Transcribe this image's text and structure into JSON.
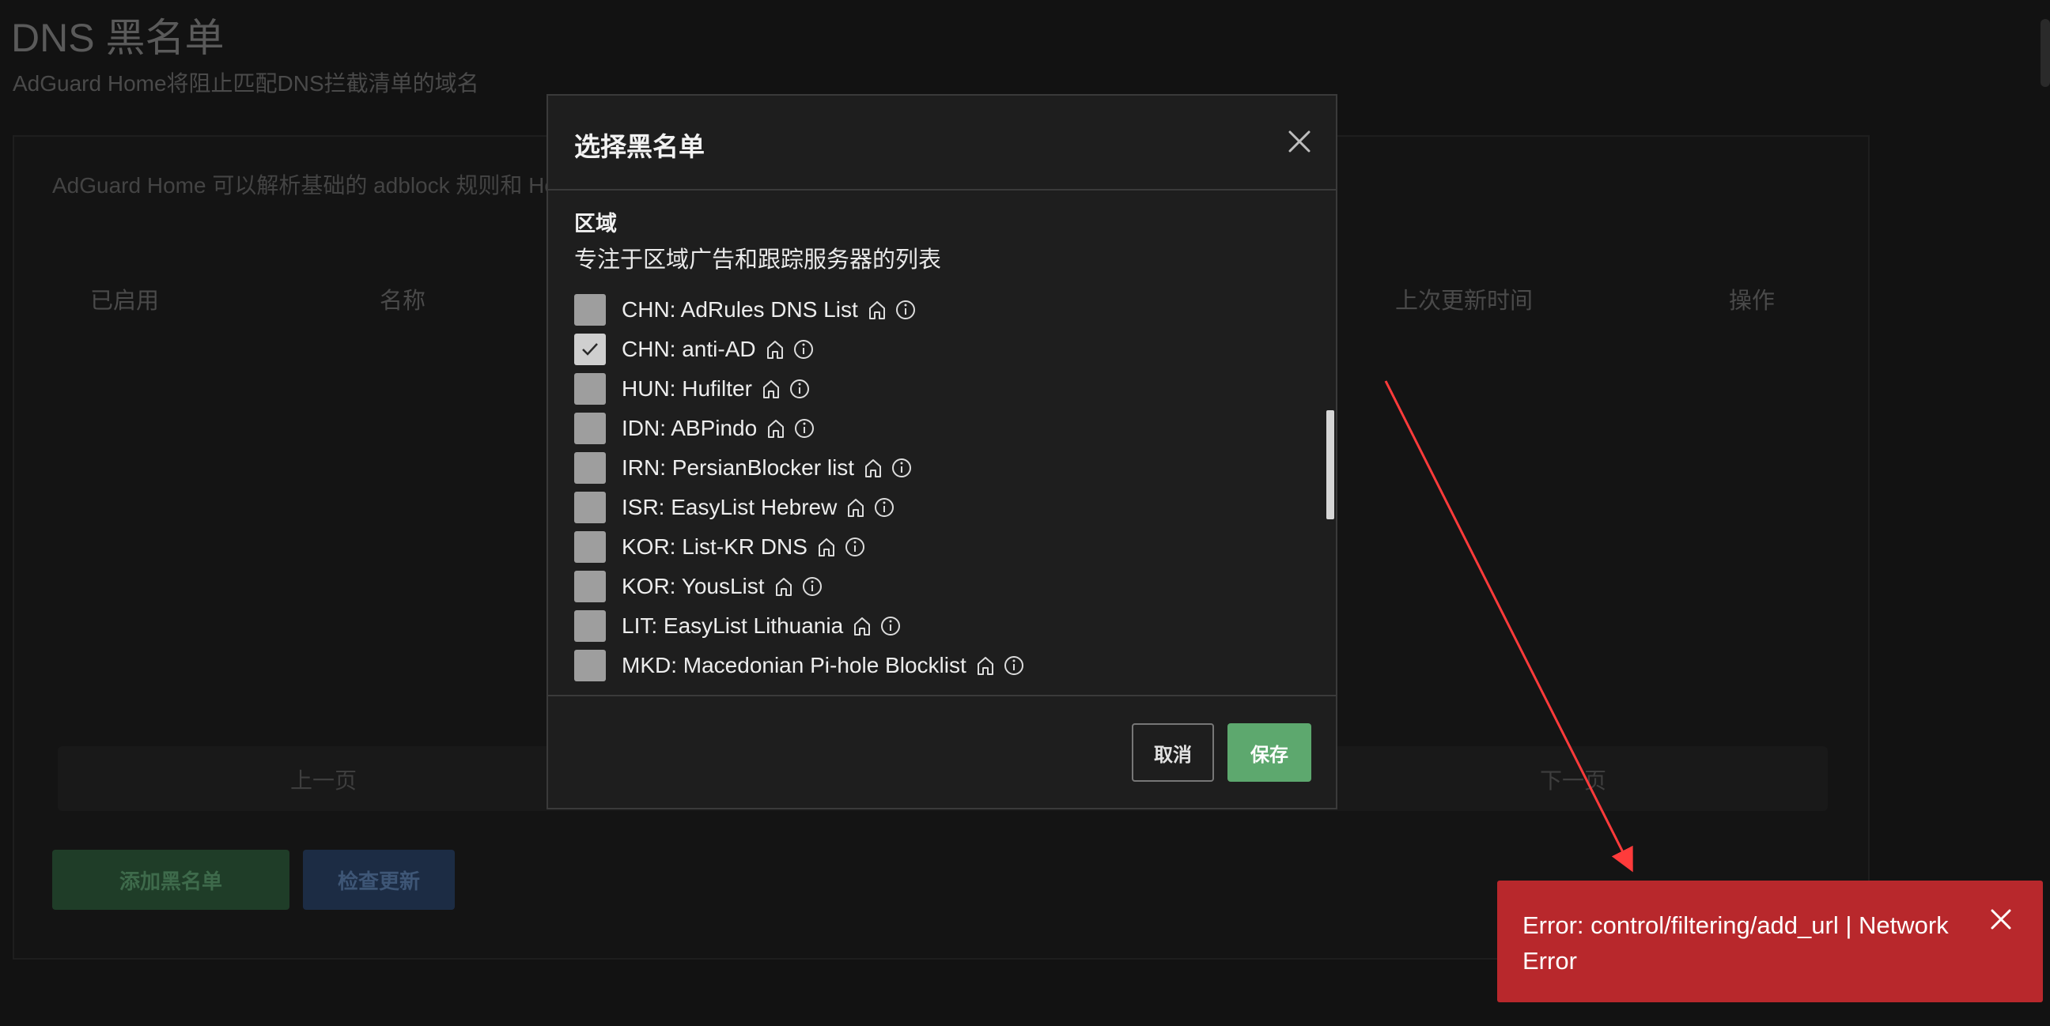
{
  "page": {
    "title": "DNS 黑名单",
    "subtitle": "AdGuard Home将阻止匹配DNS拦截清单的域名"
  },
  "card": {
    "description": "AdGuard Home 可以解析基础的 adblock 规则和 Ho",
    "columns": [
      "已启用",
      "名称",
      "上次更新时间",
      "操作"
    ],
    "pager": {
      "prev": "上一页",
      "next": "下一页"
    },
    "add_button": "添加黑名单",
    "check_button": "检查更新"
  },
  "modal": {
    "title": "选择黑名单",
    "section_title": "区域",
    "section_desc": "专注于区域广告和跟踪服务器的列表",
    "items": [
      {
        "label": "CHN: AdRules DNS List",
        "checked": false
      },
      {
        "label": "CHN: anti-AD",
        "checked": true
      },
      {
        "label": "HUN: Hufilter",
        "checked": false
      },
      {
        "label": "IDN: ABPindo",
        "checked": false
      },
      {
        "label": "IRN: PersianBlocker list",
        "checked": false
      },
      {
        "label": "ISR: EasyList Hebrew",
        "checked": false
      },
      {
        "label": "KOR: List-KR DNS",
        "checked": false
      },
      {
        "label": "KOR: YousList",
        "checked": false
      },
      {
        "label": "LIT: EasyList Lithuania",
        "checked": false
      },
      {
        "label": "MKD: Macedonian Pi-hole Blocklist",
        "checked": false
      }
    ],
    "cancel": "取消",
    "save": "保存"
  },
  "toast": {
    "message": "Error: control/filtering/add_url | Network Error"
  },
  "colors": {
    "save_green": "#5da86e",
    "error_red": "#b8282c",
    "annotation_arrow": "#ff3b3b"
  }
}
